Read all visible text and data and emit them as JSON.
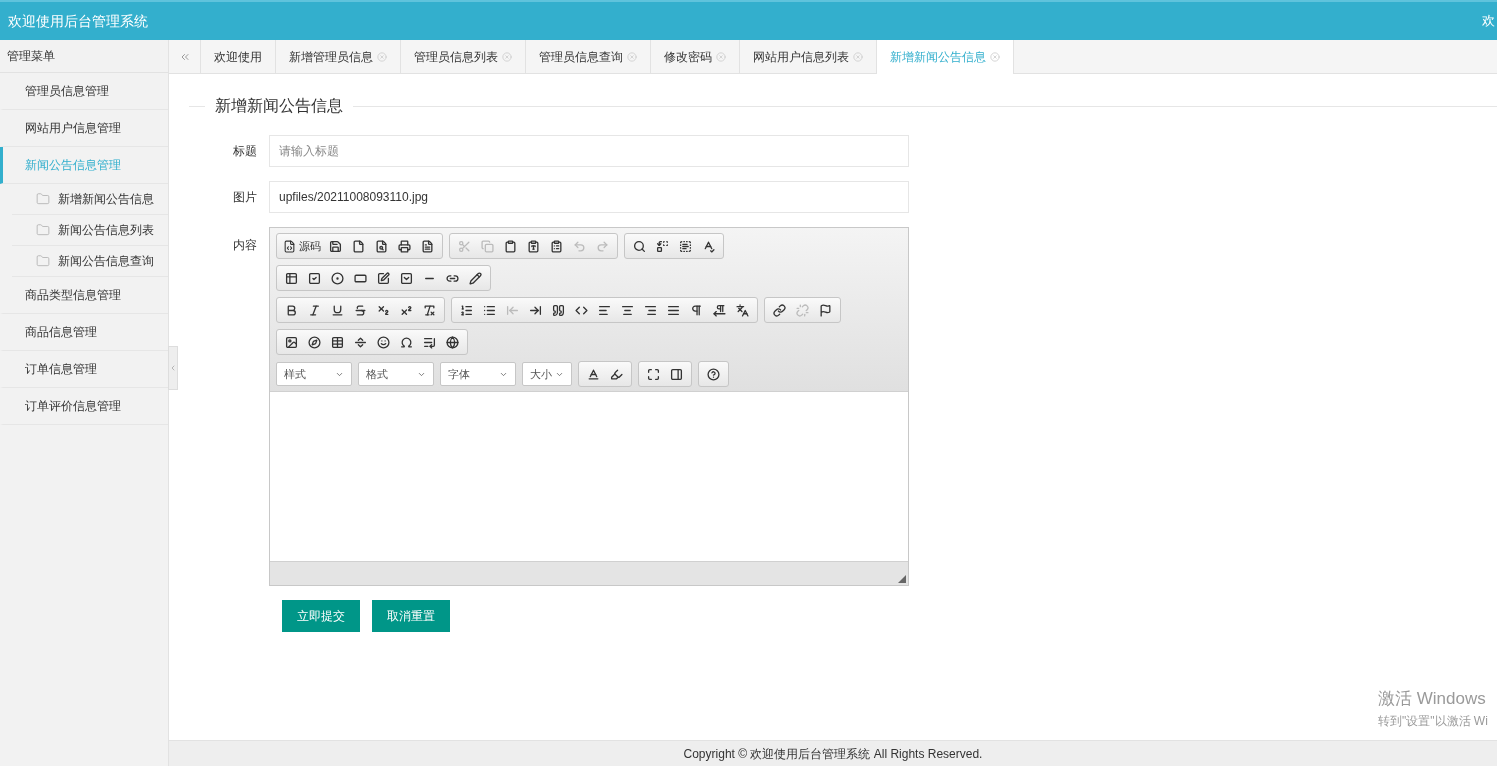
{
  "header": {
    "title": "欢迎使用后台管理系统",
    "user_text": "欢"
  },
  "sidebar": {
    "title": "管理菜单",
    "items": [
      {
        "label": "管理员信息管理",
        "selected": false
      },
      {
        "label": "网站用户信息管理",
        "selected": false
      },
      {
        "label": "新闻公告信息管理",
        "selected": true,
        "children": [
          {
            "label": "新增新闻公告信息"
          },
          {
            "label": "新闻公告信息列表"
          },
          {
            "label": "新闻公告信息查询"
          }
        ]
      },
      {
        "label": "商品类型信息管理",
        "selected": false
      },
      {
        "label": "商品信息管理",
        "selected": false
      },
      {
        "label": "订单信息管理",
        "selected": false
      },
      {
        "label": "订单评价信息管理",
        "selected": false
      }
    ]
  },
  "tabs": [
    {
      "label": "欢迎使用",
      "selected": false,
      "closable": false
    },
    {
      "label": "新增管理员信息",
      "selected": false,
      "closable": true
    },
    {
      "label": "管理员信息列表",
      "selected": false,
      "closable": true
    },
    {
      "label": "管理员信息查询",
      "selected": false,
      "closable": true
    },
    {
      "label": "修改密码",
      "selected": false,
      "closable": true
    },
    {
      "label": "网站用户信息列表",
      "selected": false,
      "closable": true
    },
    {
      "label": "新增新闻公告信息",
      "selected": true,
      "closable": true
    }
  ],
  "form": {
    "legend": "新增新闻公告信息",
    "fields": [
      {
        "label": "标题",
        "placeholder": "请输入标题"
      },
      {
        "label": "图片",
        "value": "upfiles/20211008093110.jpg"
      }
    ],
    "content_label": "内容",
    "editor": {
      "source_label": "源码",
      "dropdowns": [
        "样式",
        "格式",
        "字体",
        "大小"
      ]
    },
    "buttons": [
      "立即提交",
      "取消重置"
    ]
  },
  "footer": "Copyright © 欢迎使用后台管理系统 All Rights Reserved.",
  "os_notice": {
    "title": "激活 Windows",
    "text": "转到\"设置\"以激活 Wi"
  }
}
